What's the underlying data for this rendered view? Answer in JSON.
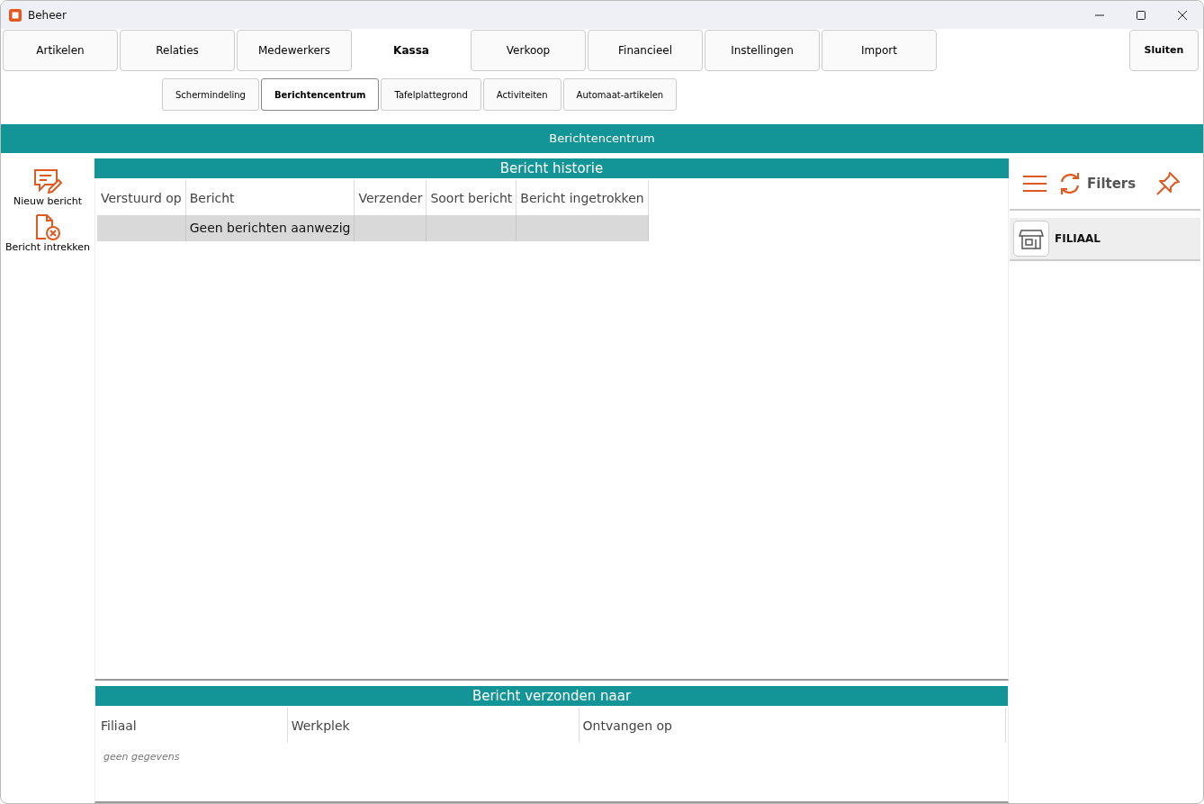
{
  "window": {
    "title": "Beheer"
  },
  "main_tabs": [
    {
      "label": "Artikelen",
      "selected": false
    },
    {
      "label": "Relaties",
      "selected": false
    },
    {
      "label": "Medewerkers",
      "selected": false
    },
    {
      "label": "Kassa",
      "selected": true
    },
    {
      "label": "Verkoop",
      "selected": false
    },
    {
      "label": "Financieel",
      "selected": false
    },
    {
      "label": "Instellingen",
      "selected": false
    },
    {
      "label": "Import",
      "selected": false
    }
  ],
  "close_button": "Sluiten",
  "sub_tabs": [
    {
      "label": "Schermindeling",
      "selected": false
    },
    {
      "label": "Berichtencentrum",
      "selected": true
    },
    {
      "label": "Tafelplattegrond",
      "selected": false
    },
    {
      "label": "Activiteiten",
      "selected": false
    },
    {
      "label": "Automaat-artikelen",
      "selected": false
    }
  ],
  "page_title": "Berichtencentrum",
  "actions": [
    {
      "kind": "new",
      "label": "Nieuw bericht"
    },
    {
      "kind": "revoke",
      "label": "Bericht intrekken"
    }
  ],
  "history": {
    "title": "Bericht historie",
    "columns": [
      "Verstuurd op",
      "Bericht",
      "Verzender",
      "Soort bericht",
      "Bericht ingetrokken"
    ],
    "rows": [
      [
        "",
        "Geen berichten aanwezig",
        "",
        "",
        ""
      ]
    ]
  },
  "recipients": {
    "title": "Bericht verzonden naar",
    "columns": [
      "Filiaal",
      "Werkplek",
      "Ontvangen op"
    ],
    "empty": "geen gegevens"
  },
  "filters": {
    "label": "Filters",
    "items": [
      {
        "label": "FILIAAL"
      }
    ]
  }
}
